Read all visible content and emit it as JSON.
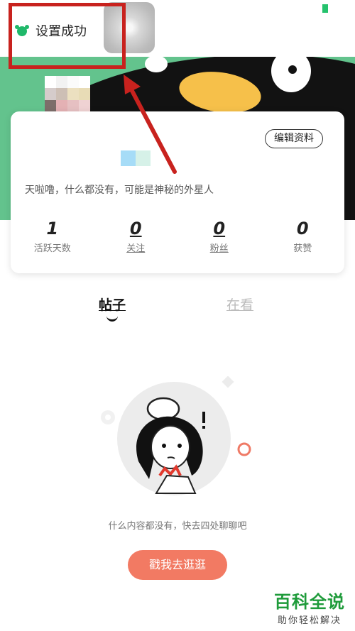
{
  "toast": {
    "text": "设置成功"
  },
  "profile": {
    "edit_label": "编辑资料",
    "bio": "天啦噜，什么都没有，可能是神秘的外星人",
    "stats": [
      {
        "value": "1",
        "label": "活跃天数"
      },
      {
        "value": "0",
        "label": "关注"
      },
      {
        "value": "0",
        "label": "粉丝"
      },
      {
        "value": "0",
        "label": "获赞"
      }
    ]
  },
  "tabs": [
    {
      "label": "帖子",
      "active": true
    },
    {
      "label": "在看",
      "active": false
    }
  ],
  "empty": {
    "text": "什么内容都没有，快去四处聊聊吧",
    "button_label": "戳我去逛逛"
  },
  "watermark": {
    "title": "百科全说",
    "subtitle": "助你轻松解决"
  },
  "colors": {
    "accent": "#f27a63",
    "banner": "#63c38d",
    "annotation": "#c8221e",
    "brand_green": "#1e9b3a"
  }
}
